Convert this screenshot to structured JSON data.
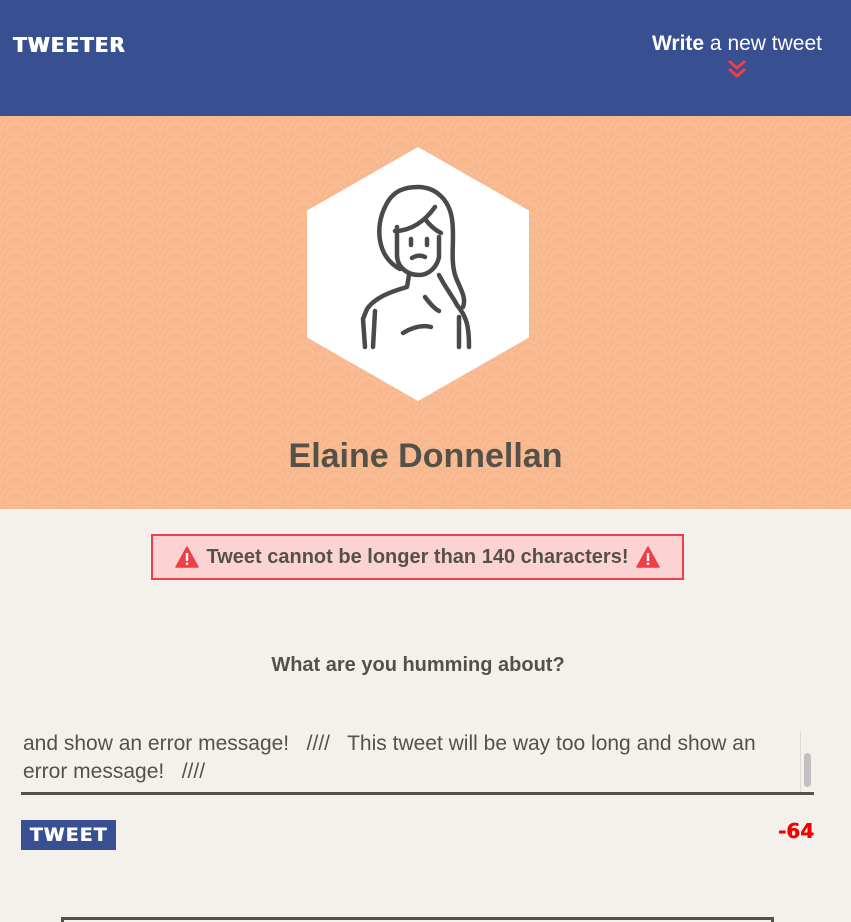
{
  "nav": {
    "brand": "TWEETER",
    "compose_bold": "Write",
    "compose_rest": " a new tweet",
    "compose_icon": "double-chevron-down-icon",
    "compose_icon_color": "#ef3e47"
  },
  "profile": {
    "first_name": "Elaine",
    "last_name": " Donnellan",
    "avatar_icon": "woman-avatar-icon"
  },
  "error": {
    "message": "Tweet cannot be longer than 140 characters!",
    "icon": "warning-icon"
  },
  "composer": {
    "prompt": "What are you humming about?",
    "value": "be way too long and show an error message!   ////   This tweet will be way too long and show an error message!   ////   This tweet will be way too long and show an error message!   ////",
    "tweet_label": "TWEET",
    "counter": "-64"
  },
  "colors": {
    "nav": "#384f92",
    "header": "#f8b78d",
    "background": "#f4f1ec",
    "error_border": "#ef3e47",
    "error_fill": "#fcd3d3",
    "counter": "#f00000"
  }
}
